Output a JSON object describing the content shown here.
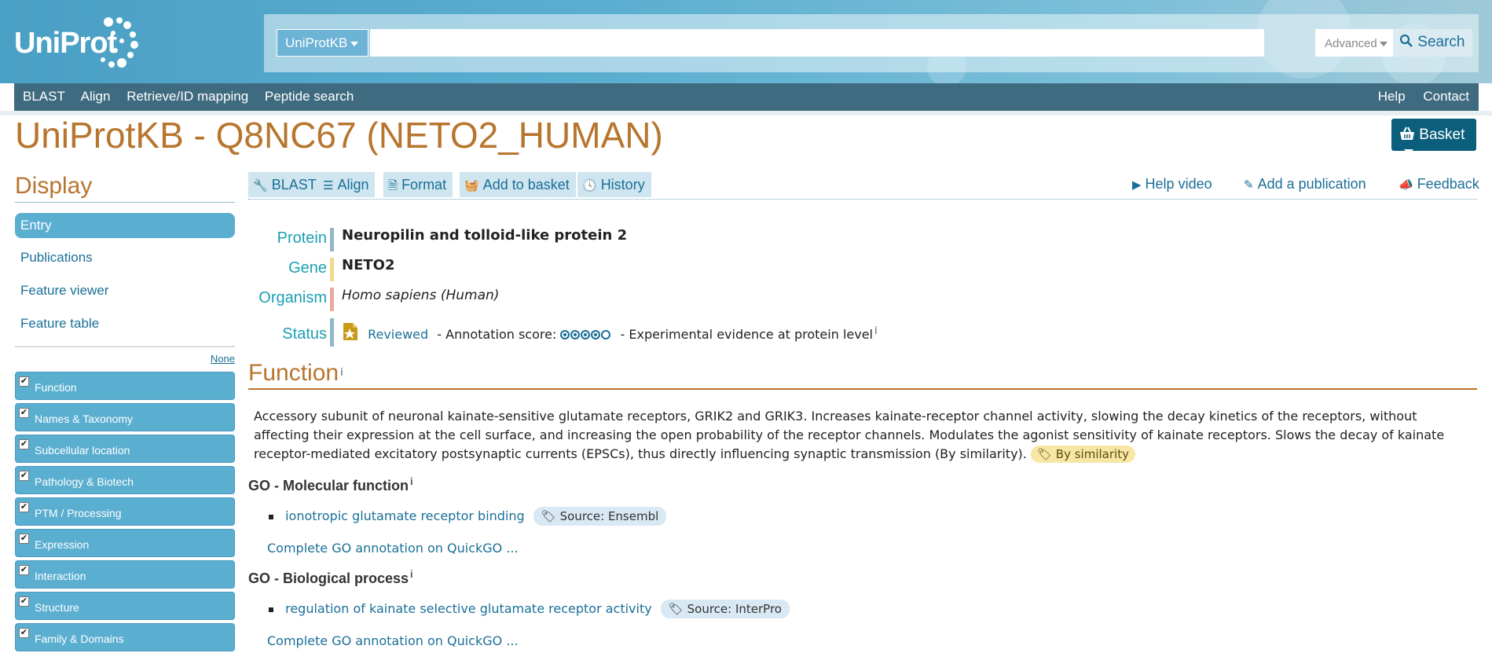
{
  "header": {
    "logo_text": "UniProt",
    "search": {
      "database": "UniProtKB",
      "query": "",
      "advanced_label": "Advanced",
      "search_label": "Search"
    },
    "nav_left": [
      "BLAST",
      "Align",
      "Retrieve/ID mapping",
      "Peptide search"
    ],
    "nav_right": [
      "Help",
      "Contact"
    ]
  },
  "page": {
    "title": "UniProtKB - Q8NC67 (NETO2_HUMAN)",
    "basket_label": "Basket"
  },
  "sidebar": {
    "title": "Display",
    "links": [
      "Entry",
      "Publications",
      "Feature viewer",
      "Feature table"
    ],
    "none_label": "None",
    "sections": [
      "Function",
      "Names & Taxonomy",
      "Subcellular location",
      "Pathology & Biotech",
      "PTM / Processing",
      "Expression",
      "Interaction",
      "Structure",
      "Family & Domains"
    ]
  },
  "toolbar": {
    "buttons": [
      "BLAST",
      "Align",
      "Format",
      "Add to basket",
      "History"
    ],
    "links": [
      "Help video",
      "Add a publication",
      "Feedback"
    ]
  },
  "entry": {
    "protein_label": "Protein",
    "protein": "Neuropilin and tolloid-like protein 2",
    "gene_label": "Gene",
    "gene": "NETO2",
    "organism_label": "Organism",
    "organism": "Homo sapiens (Human)",
    "status_label": "Status",
    "status": "Reviewed",
    "annotation_prefix": "- Annotation score:",
    "annotation_score": 4,
    "annotation_max": 5,
    "annotation_suffix": "- Experimental evidence at protein level",
    "info_mark": "i"
  },
  "function": {
    "heading": "Function",
    "text": "Accessory subunit of neuronal kainate-sensitive glutamate receptors, GRIK2 and GRIK3. Increases kainate-receptor channel activity, slowing the decay kinetics of the receptors, without affecting their expression at the cell surface, and increasing the open probability of the receptor channels. Modulates the agonist sensitivity of kainate receptors. Slows the decay of kainate receptor-mediated excitatory postsynaptic currents (EPSCs), thus directly influencing synaptic transmission (By similarity).",
    "evidence_badge": "By similarity",
    "go_molecular": {
      "heading": "GO - Molecular function",
      "term": "ionotropic glutamate receptor binding",
      "source": "Source: Ensembl",
      "quickgo": "Complete GO annotation on QuickGO ..."
    },
    "go_biological": {
      "heading": "GO - Biological process",
      "term": "regulation of kainate selective glutamate receptor activity",
      "source": "Source: InterPro",
      "quickgo": "Complete GO annotation on QuickGO ..."
    }
  },
  "colors": {
    "accent": "#b7752e",
    "link": "#1a6f98",
    "nav": "#3f6b80",
    "sidebar_active": "#5aaed0",
    "basket": "#0b5f7c"
  }
}
